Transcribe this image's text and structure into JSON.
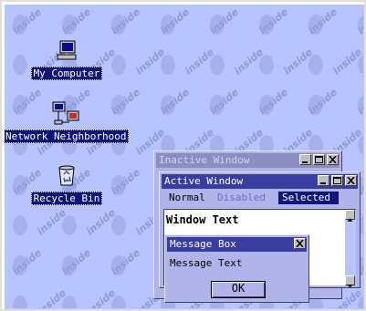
{
  "desktop": {
    "watermark_text": "inside",
    "icons": [
      {
        "label": "My Computer",
        "icon": "computer-icon"
      },
      {
        "label": "Network Neighborhood",
        "icon": "network-icon"
      },
      {
        "label": "Recycle Bin",
        "icon": "recycle-bin-icon"
      }
    ]
  },
  "inactive_window": {
    "title": "Inactive Window"
  },
  "active_window": {
    "title": "Active Window",
    "menu": {
      "normal": "Normal",
      "disabled": "Disabled",
      "selected": "Selected"
    },
    "body_text": "Window Text"
  },
  "message_box": {
    "title": "Message Box",
    "text": "Message Text",
    "ok_label": "OK"
  },
  "colors": {
    "desktop": "#b8c4ff",
    "active_title": "#3a3da0",
    "inactive_title": "#8a8ec0",
    "selection": "#0f157a",
    "window_face": "#b0b4ea"
  }
}
